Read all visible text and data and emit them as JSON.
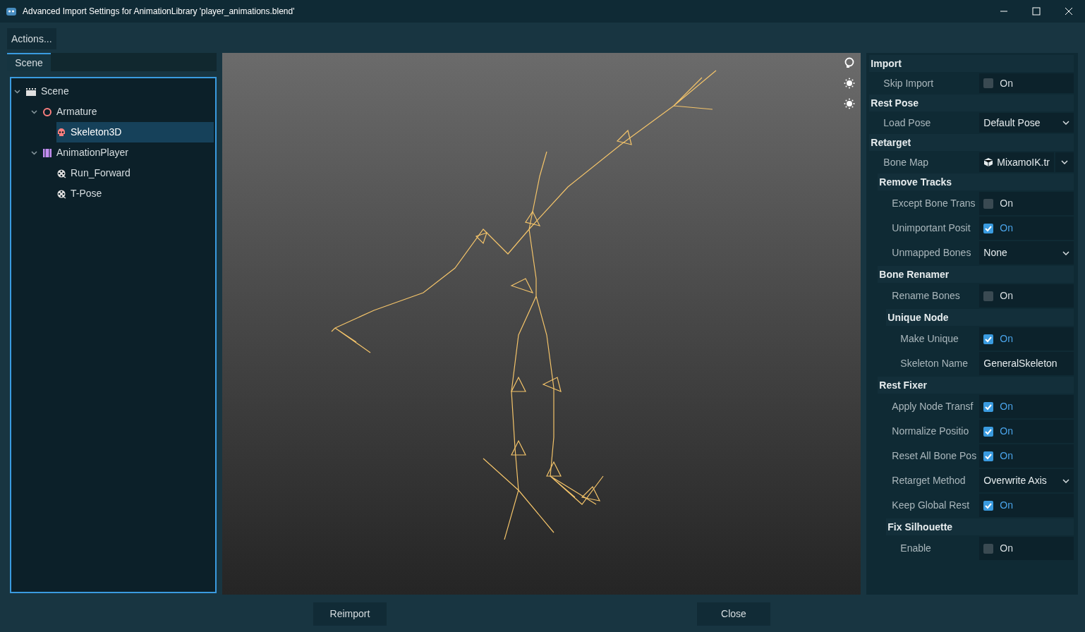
{
  "window": {
    "title": "Advanced Import Settings for AnimationLibrary 'player_animations.blend'"
  },
  "toolbar": {
    "actions_button": "Actions..."
  },
  "tabs": [
    {
      "label": "Scene",
      "selected": true
    }
  ],
  "scene_tree": [
    {
      "label": "Scene",
      "kind": "scene",
      "expanded": true,
      "selected": false,
      "children": [
        {
          "label": "Armature",
          "kind": "node3d",
          "expanded": true,
          "selected": false,
          "children": [
            {
              "label": "Skeleton3D",
              "kind": "skeleton",
              "selected": true
            }
          ]
        },
        {
          "label": "AnimationPlayer",
          "kind": "player",
          "expanded": true,
          "selected": false,
          "children": [
            {
              "label": "Run_Forward",
              "kind": "animation",
              "selected": false
            },
            {
              "label": "T-Pose",
              "kind": "animation",
              "selected": false
            }
          ]
        }
      ]
    }
  ],
  "inspector": [
    {
      "kind": "section",
      "title": "Import",
      "children": [
        {
          "kind": "check",
          "label": "Skip Import",
          "checked": false,
          "value": "On"
        }
      ]
    },
    {
      "kind": "section",
      "title": "Rest Pose",
      "children": [
        {
          "kind": "select",
          "label": "Load Pose",
          "value": "Default Pose"
        }
      ]
    },
    {
      "kind": "section",
      "title": "Retarget",
      "children": [
        {
          "kind": "resource",
          "label": "Bone Map",
          "value": "MixamoIK.tr"
        },
        {
          "kind": "section",
          "title": "Remove Tracks",
          "children": [
            {
              "kind": "check",
              "label": "Except Bone Trans",
              "checked": false,
              "value": "On"
            },
            {
              "kind": "check",
              "label": "Unimportant Posit",
              "checked": true,
              "value": "On"
            },
            {
              "kind": "select",
              "label": "Unmapped Bones",
              "value": "None"
            }
          ]
        },
        {
          "kind": "section",
          "title": "Bone Renamer",
          "children": [
            {
              "kind": "check",
              "label": "Rename Bones",
              "checked": false,
              "value": "On"
            },
            {
              "kind": "section",
              "title": "Unique Node",
              "children": [
                {
                  "kind": "check",
                  "label": "Make Unique",
                  "checked": true,
                  "value": "On"
                },
                {
                  "kind": "text",
                  "label": "Skeleton Name",
                  "value": "GeneralSkeleton"
                }
              ]
            }
          ]
        },
        {
          "kind": "section",
          "title": "Rest Fixer",
          "children": [
            {
              "kind": "check",
              "label": "Apply Node Transf",
              "checked": true,
              "value": "On"
            },
            {
              "kind": "check",
              "label": "Normalize Positio",
              "checked": true,
              "value": "On"
            },
            {
              "kind": "check",
              "label": "Reset All Bone Pos",
              "checked": true,
              "value": "On"
            },
            {
              "kind": "select",
              "label": "Retarget Method",
              "value": "Overwrite Axis"
            },
            {
              "kind": "check",
              "label": "Keep Global Rest",
              "checked": true,
              "value": "On"
            },
            {
              "kind": "section",
              "title": "Fix Silhouette",
              "children": [
                {
                  "kind": "check",
                  "label": "Enable",
                  "checked": false,
                  "value": "On"
                }
              ]
            }
          ]
        }
      ]
    }
  ],
  "buttons": [
    "Reimport",
    "Close"
  ]
}
